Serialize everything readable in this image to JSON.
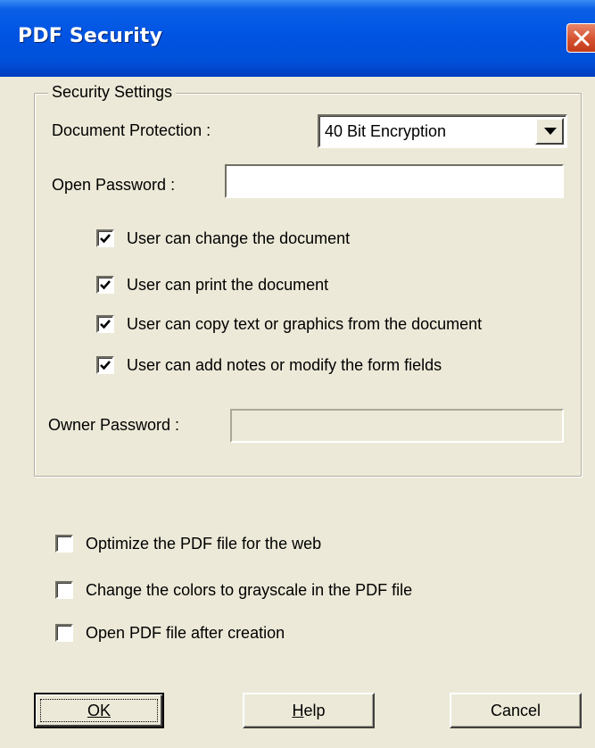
{
  "window": {
    "title": "PDF Security"
  },
  "security": {
    "group_label": "Security Settings",
    "protection_label": "Document Protection :",
    "protection_value": "40 Bit Encryption",
    "open_password_label": "Open Password :",
    "open_password_value": "",
    "permissions": [
      {
        "label": "User can change the document",
        "checked": true
      },
      {
        "label": "User can print the document",
        "checked": true
      },
      {
        "label": "User can copy text or graphics from the document",
        "checked": true
      },
      {
        "label": "User can add notes or modify the form fields",
        "checked": true
      }
    ],
    "owner_password_label": "Owner Password :",
    "owner_password_value": "",
    "owner_password_enabled": false
  },
  "options": [
    {
      "label": "Optimize the PDF file for the web",
      "checked": false
    },
    {
      "label": "Change the colors to grayscale in the PDF file",
      "checked": false
    },
    {
      "label": "Open PDF file after creation",
      "checked": false
    }
  ],
  "buttons": {
    "ok": "OK",
    "help": "Help",
    "cancel": "Cancel"
  },
  "icons": {
    "close": "close-icon",
    "dropdown": "chevron-down-icon",
    "check": "checkmark-icon"
  },
  "colors": {
    "titlebar": "#0054e3",
    "close_button": "#d4512f",
    "dialog_background": "#ece9d8"
  }
}
